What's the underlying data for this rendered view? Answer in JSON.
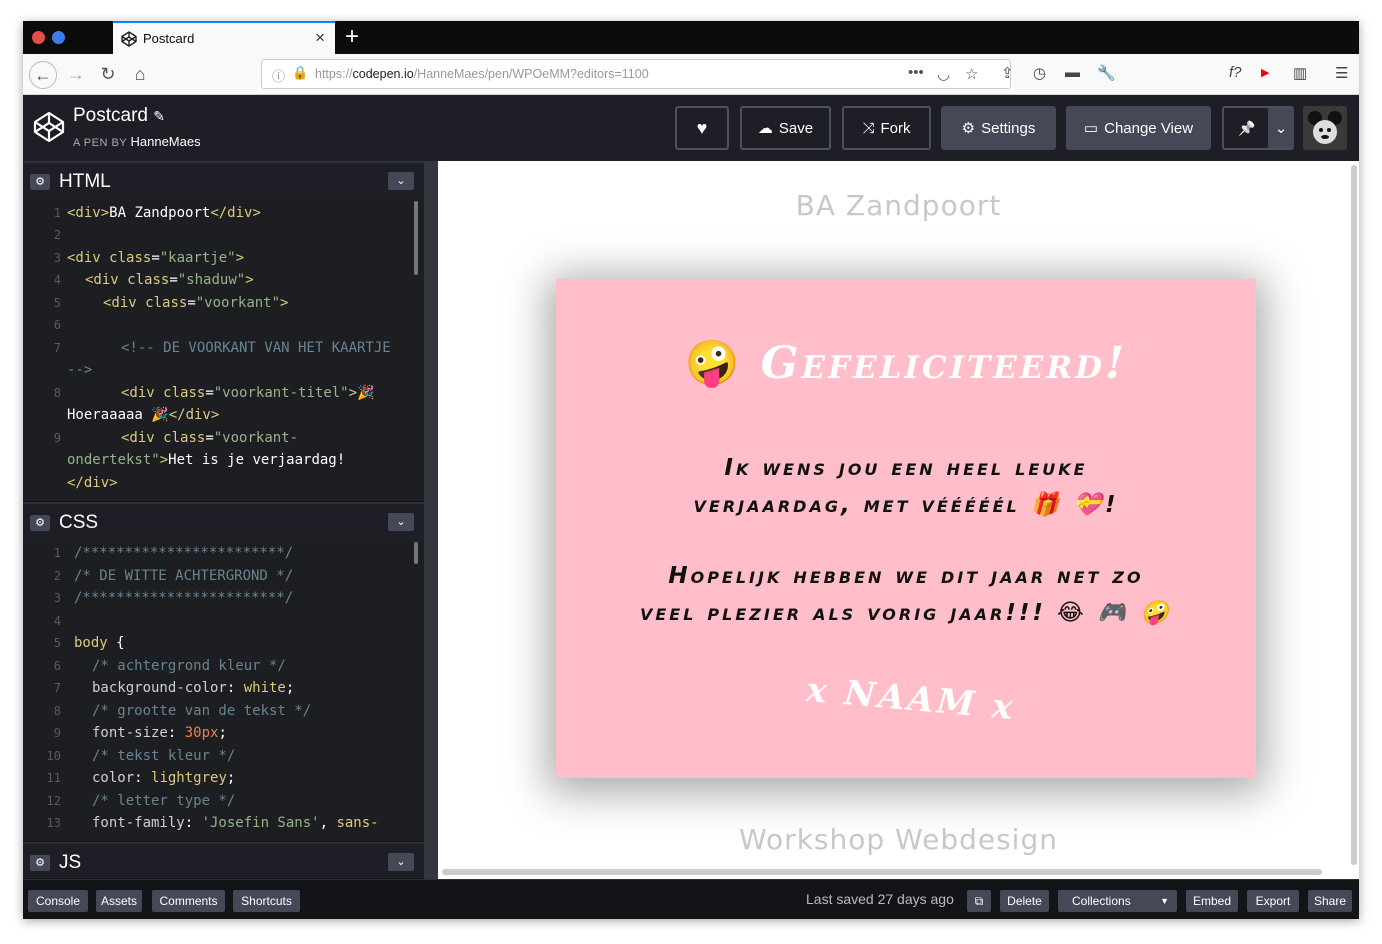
{
  "browser": {
    "tab_title": "Postcard",
    "new_tab": "+",
    "url_host": "codepen.io",
    "url_prefix": "https://",
    "url_path": "/HanneMaes/pen/WPOeMM?editors=1100",
    "url_more": "•••"
  },
  "header": {
    "pen_title": "Postcard",
    "byline_prefix": "A PEN BY",
    "author": "HanneMaes",
    "buttons": {
      "save": "Save",
      "fork": "Fork",
      "settings": "Settings",
      "change_view": "Change View"
    }
  },
  "editors": {
    "html": {
      "title": "HTML",
      "line_numbers": [
        "1",
        "2",
        "3",
        "4",
        "5",
        "6",
        "7",
        "8",
        "9"
      ]
    },
    "css": {
      "title": "CSS",
      "line_numbers": [
        "1",
        "2",
        "3",
        "4",
        "5",
        "6",
        "7",
        "8",
        "9",
        "10",
        "11",
        "12",
        "13"
      ]
    },
    "js": {
      "title": "JS"
    }
  },
  "preview": {
    "top_text": "BA Zandpoort",
    "bottom_text": "Workshop Webdesign",
    "card": {
      "title": "Gefeliciteerd!",
      "title_emoji": "🤪",
      "line1": "Ik wens jou een heel leuke",
      "line2": "verjaardag, met vééééél 🎁 💝!",
      "line3": "Hopelijk hebben we dit jaar net zo",
      "line4": "veel plezier als vorig jaar!!! 😂 🎮 🤪",
      "sign": "x NAAM x"
    }
  },
  "footer": {
    "console": "Console",
    "assets": "Assets",
    "comments": "Comments",
    "shortcuts": "Shortcuts",
    "last_saved": "Last saved 27 days ago",
    "delete": "Delete",
    "collections": "Collections",
    "embed": "Embed",
    "export": "Export",
    "share": "Share"
  },
  "colors": {
    "card_bg": "#ffbec9",
    "editor_bg": "#1d1e22",
    "header_bg": "#1e1f26",
    "button_grey": "#444857",
    "firefox_accent": "#0a84ff"
  },
  "icons": {
    "close": "×",
    "heart": "♥",
    "cloud": "☁",
    "fork": "⤨",
    "gear": "⚙",
    "pin": "📌",
    "chevron": "⌄"
  }
}
